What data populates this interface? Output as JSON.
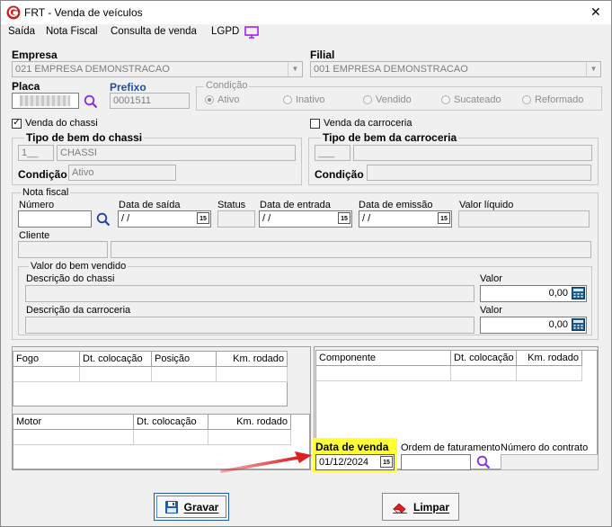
{
  "window": {
    "title": "FRT - Venda de veículos",
    "close_glyph": "✕"
  },
  "menu": {
    "items": [
      "Saída",
      "Nota Fiscal",
      "Consulta de venda",
      "LGPD"
    ]
  },
  "empresa": {
    "label": "Empresa",
    "value": "021 EMPRESA DEMONSTRACAO"
  },
  "filial": {
    "label": "Filial",
    "value": "001 EMPRESA DEMONSTRACAO"
  },
  "placa": {
    "label": "Placa",
    "value": ""
  },
  "prefixo": {
    "label": "Prefixo",
    "value": "0001511"
  },
  "condicao": {
    "label": "Condição",
    "options": [
      "Ativo",
      "Inativo",
      "Vendido",
      "Sucateado",
      "Reformado"
    ],
    "selected": "Ativo"
  },
  "venda_chassi": {
    "label": "Venda do chassi",
    "checked": true
  },
  "venda_carroceria": {
    "label": "Venda da carroceria",
    "checked": false
  },
  "tipo_chassi": {
    "title": "Tipo de bem do chassi",
    "code": "1__",
    "name": "CHASSI",
    "condicao_label": "Condição",
    "condicao_value": "Ativo"
  },
  "tipo_carroceria": {
    "title": "Tipo de bem da carroceria",
    "code": "___",
    "name": "",
    "condicao_label": "Condição",
    "condicao_value": ""
  },
  "nota_fiscal": {
    "title": "Nota fiscal",
    "numero_label": "Número",
    "data_saida_label": "Data de saída",
    "data_saida_value": " / /",
    "status_label": "Status",
    "data_entrada_label": "Data de entrada",
    "data_entrada_value": " / /",
    "data_emissao_label": "Data de emissão",
    "data_emissao_value": " / /",
    "valor_liquido_label": "Valor líquido",
    "cliente_label": "Cliente"
  },
  "valor_bem": {
    "title": "Valor do bem vendido",
    "desc_chassi_label": "Descrição do chassi",
    "desc_carroceria_label": "Descrição da carroceria",
    "valor_label": "Valor",
    "valor_chassi": "0,00",
    "valor_carroceria": "0,00"
  },
  "fogo_grid": {
    "columns": [
      "Fogo",
      "Dt. colocação",
      "Posição",
      "Km. rodado"
    ]
  },
  "componente_grid": {
    "columns": [
      "Componente",
      "Dt. colocação",
      "Km. rodado"
    ]
  },
  "motor_grid": {
    "columns": [
      "Motor",
      "Dt. colocação",
      "Km. rodado"
    ]
  },
  "data_venda": {
    "label": "Data de venda",
    "value": "01/12/2024",
    "highlight": "#ffff33"
  },
  "ordem_faturamento": {
    "label": "Ordem de faturamento"
  },
  "numero_contrato": {
    "label": "Número do contrato"
  },
  "calendar_badge": "15",
  "buttons": {
    "gravar": "Gravar",
    "limpar": "Limpar"
  },
  "colors": {
    "accent_blue": "#1f4fa0",
    "arrow_red": "#e02020",
    "search_purple": "#8a2be2",
    "lgpd_purple": "#a020f0"
  }
}
